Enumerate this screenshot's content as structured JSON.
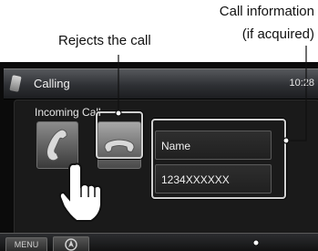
{
  "annotations": {
    "call_info_line1": "Call information",
    "call_info_line2": "(if acquired)",
    "rejects": "Rejects the call"
  },
  "screen": {
    "title": "Calling",
    "clock": "10:28",
    "panel_title": "Incoming Call",
    "caller_name": "Name",
    "caller_number": "1234XXXXXX",
    "menu_label": "MENU"
  },
  "icons": [
    "phone-handset-icon",
    "accept-call-icon",
    "reject-call-icon",
    "navigation-icon",
    "pointing-hand-icon"
  ],
  "colors": {
    "screen_bg": "#0b0b0b",
    "highlight": "#d0d0d0"
  }
}
